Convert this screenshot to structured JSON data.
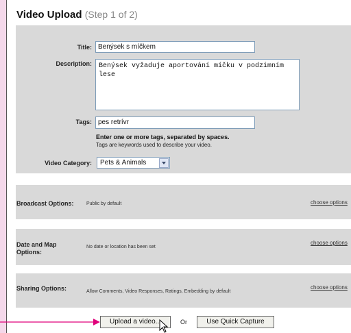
{
  "header": {
    "title": "Video Upload",
    "step": "(Step 1 of 2)"
  },
  "form": {
    "title_label": "Title:",
    "title_value": "Benýsek s míčkem",
    "description_label": "Description:",
    "description_value": "Benýsek vyžaduje aportování míčku v podzimním lese",
    "tags_label": "Tags:",
    "tags_value": "pes retrívr",
    "tags_hint_bold": "Enter one or more tags, separated by spaces.",
    "tags_hint": "Tags are keywords used to describe your video.",
    "category_label": "Video Category:",
    "category_value": "Pets & Animals"
  },
  "options": [
    {
      "label": "Broadcast Options:",
      "description": "Public by default",
      "link": "choose options"
    },
    {
      "label": "Date and Map Options:",
      "description": "No date or location has been set",
      "link": "choose options"
    },
    {
      "label": "Sharing Options:",
      "description": "Allow Comments, Video Responses, Ratings, Embedding by default",
      "link": "choose options"
    }
  ],
  "actions": {
    "upload_label": "Upload a video...",
    "or_text": "Or",
    "capture_label": "Use Quick Capture"
  },
  "colors": {
    "background": "#f4d8ea",
    "panel": "#d9d9d9",
    "annotation_arrow": "#e0007a"
  },
  "icons": {
    "cursor": "mouse-pointer-icon",
    "dropdown": "chevron-down-icon"
  }
}
